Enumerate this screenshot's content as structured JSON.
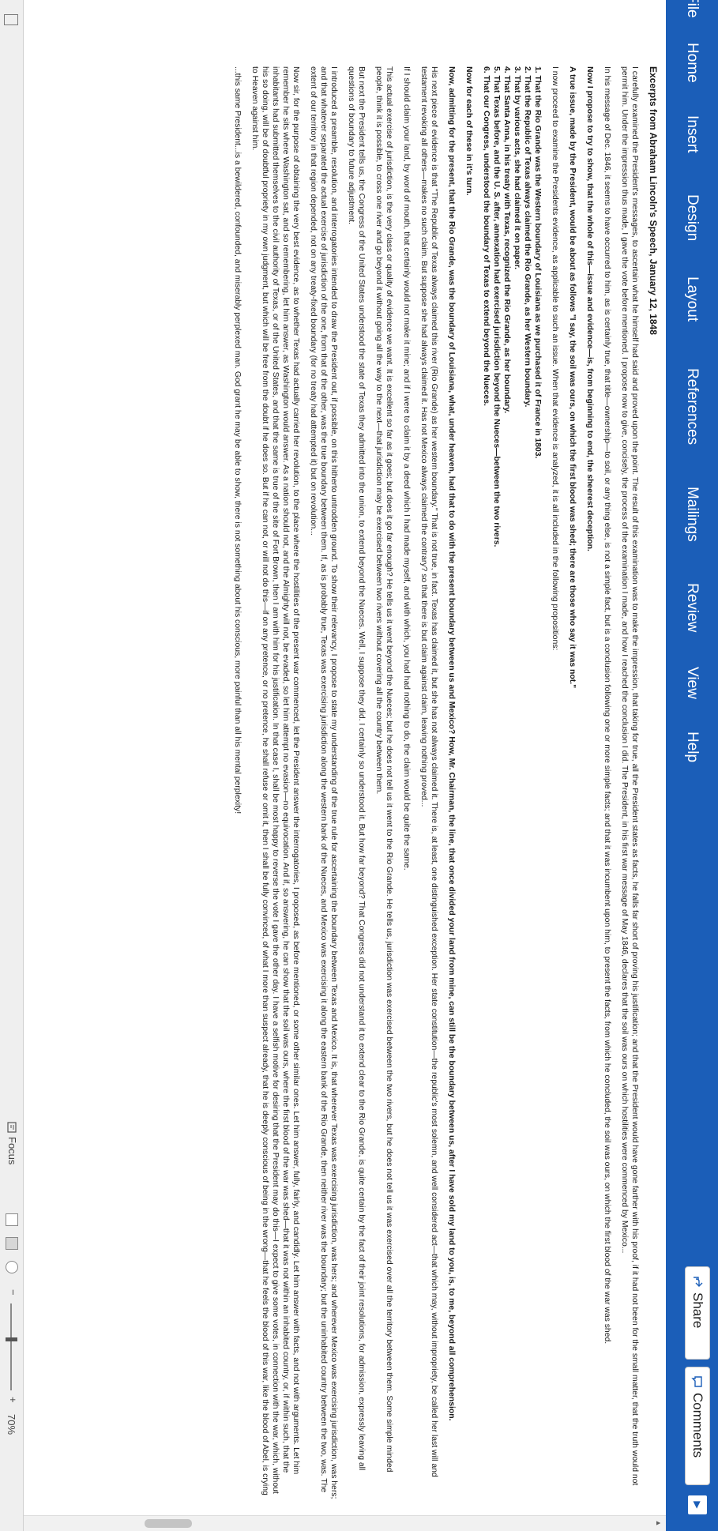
{
  "ribbon": {
    "tabs": [
      "File",
      "Home",
      "Insert",
      "Design",
      "Layout",
      "References",
      "Mailings",
      "Review",
      "View",
      "Help"
    ],
    "share_label": "Share",
    "comments_label": "Comments",
    "accent_color": "#1b5eb8"
  },
  "document": {
    "title": "Excerpts from Abraham Lincoln's Speech, January 12, 1848",
    "p1": "I carefully examined the President's messages, to ascertain what he himself had said and proved upon the point. The result of this examination was to make the impression, that taking for true, all the President states as facts, he falls far short of proving his justification; and that the President would have gone farther with his proof, if it had not been for the small matter, that the truth would not permit him. Under the impression thus made, I gave the vote before mentioned. I propose now to give, concisely, the process of the examination I made, and how I reached the conclusion I did. The President, in his first war message of May 1846, declares that the soil was ours on which hostilities were commenced by Mexico...",
    "p2": "In his message of Dec. 1846, it seems to have occurred to him, as is certainly true, that title—ownership—to soil, or any thing else, is not a simple fact, but is a conclusion following one or more simple facts; and that it was incumbent upon him, to present the facts, from which he concluded, the soil was ours, on which the first blood of the war was shed.",
    "p3": "Now I propose to try to show, that the whole of this—issue and evidence—is, from beginning to end, the sheerest deception.",
    "p4": "A true issue, made by the President, would be about as follows \"I say, the soil was ours, on which the first blood was shed; there are those who say it was not.\"",
    "p5": "I now proceed to examine the Presidents evidence, as applicable to such an issue. When that evidence is analyzed, it is all included in the following propositions:",
    "propositions": [
      "1. That the Rio Grande was the Western boundary of Louisiana as we purchased it of France in 1803.",
      "2. That the Republic of Texas always claimed the Rio Grande, as her Western boundary.",
      "3. That by various acts, she had claimed it on paper.",
      "4. That Santa Anna, in his treaty with Texas, recognized the Rio Grande, as her boundary.",
      "5. That Texas before, and the U. S. after, annexation had exercised jurisdiction beyond the Nueces—between the two rivers.",
      "6. That our Congress, understood the boundary of Texas to extend beyond the Nueces."
    ],
    "p6": "Now for each of these in it's turn.",
    "p7": "Now, admitting for the present, that the Rio Grande, was the boundary of Louisiana, what, under heaven, had that to do with the present boundary between us and Mexico? How, Mr. Chairman, the line, that once divided your land from mine, can still be the boundary between us, after I have sold my land to you, is, to me, beyond all comprehension.",
    "p8": "His next piece of evidence is that \"The Republic of Texas always claimed this river (Rio Grande) as her western boundary.\" That is not true, in fact. Texas has claimed it, but she has not always claimed it. There is, at least, one distinguished exception. Her state constitution—the republic's most solemn, and well considered act—that which may, without impropriety, be called her last will and testament revoking all others—makes no such claim. But suppose she had always claimed it. Has not Mexico always claimed the contrary? so that there is but claim against claim, leaving nothing proved...",
    "p9": "If I should claim your land, by word of mouth, that certainly would not make it mine; and if I were to claim it by a deed which I had made myself, and with which, you had had nothing to do, the claim would be quite the same.",
    "p10": "This actual exercise of jurisdiction, is the very class or quality of evidence we want. It is excellent so far as it goes; but does it go far enough? He tells us it went beyond the Nueces; but he does not tell us it went to the Rio Grande. He tells us, jurisdiction was exercised between the two rivers, but he does not tell us it was exercised over all the territory between them. Some simple minded people, think it is possible, to cross one river and go beyond it without going all the way to the next—that jurisdiction may be exercised between two rivers without covering all the country between them.",
    "p11": "But next the President tells us, the Congress of the United States understood the state of Texas they admitted into the union, to extend beyond the Nueces. Well, I suppose they did. I certainly so understood it. But how far beyond? That Congress did not understand it to extend clear to the Rio Grande, is quite certain by the fact of their joint resolutions, for admission, expressly leaving all questions of boundary to future adjustment.",
    "p12": "I introduced a preamble, resolution, and interrogatories intended to draw the President out, if possible, on this hitherto untrodden ground. To show their relevancy, I propose to state my understanding of the true rule for ascertaining the boundary between Texas and Mexico. It is, that wherever Texas was exercising jurisdiction, was hers; and wherever Mexico was exercising jurisdiction, was hers; and that whatever separated the actual exercise of jurisdiction of the one, from that of the other, was the true boundary between them. If, as is probably true, Texas was exercising jurisdiction along the western bank of the Nueces, and Mexico was exercising it along the eastern bank of the Rio Grande, then neither river was the boundary; but the uninhabited country between the two, was. The extent of our territory in that region depended, not on any treaty-fixed boundary (for no treaty had attempted it) but on revolution...",
    "p13": "Now sir, for the purpose of obtaining the very best evidence, as to whether Texas had actually carried her revolution, to the place where the hostilities of the present war commenced, let the President answer the interrogatories, I proposed, as before mentioned, or some other similar ones. Let him answer, fully, fairly, and candidly. Let him answer with facts, and not with arguments. Let him remember he sits where Washington sat, and so remembering, let him answer, as Washington would answer. As a nation should not, and the Almighty will not, be evaded, so let him attempt no evasion—no equivocation. And if, so answering, he can show that the soil was ours, where the first blood of the war was shed—that it was not within an inhabited country, or, if within such, that the inhabitants had submitted themselves to the civil authority of Texas, or of the United States, and that the same is true of the site of Fort Brown, then I am with him for his justification. In that case I, shall be most happy to reverse the vote I gave the other day. I have a selfish motive for desiring that the President may do this—I expect to give some votes, in connection with the war, which, without his so doing, will be of doubtful propriety in my own judgment, but which will be free from the doubt if he does so. But if he can not, or will not do this—if on any pretence, or no pretence, he shall refuse or omit it, then I shall be fully convinced, of what I more than suspect already, that he is deeply conscious of being in the wrong—that he feels the blood of this war, like the blood of Abel, is crying to Heaven against him.",
    "p14": "...this same President...is a bewildered, confounded, and miserably perplexed man. God grant he may be able to show, there is not something about his conscious, more painful than all his mental perplexity!"
  },
  "statusbar": {
    "focus_label": "Focus",
    "zoom_level": "70%",
    "zoom_out": "−",
    "zoom_in": "+"
  }
}
